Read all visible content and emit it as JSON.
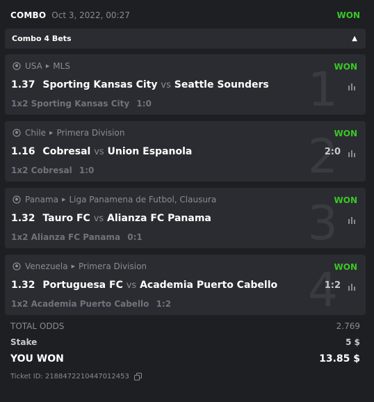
{
  "header": {
    "title": "COMBO",
    "date": "Oct 3, 2022, 00:27",
    "status": "WON"
  },
  "combo": {
    "label": "Combo 4 Bets",
    "toggle_icon": "caret-up-icon"
  },
  "bets": [
    {
      "country": "USA",
      "league": "MLS",
      "status": "WON",
      "odds": "1.37",
      "home": "Sporting Kansas City",
      "vs": "vs",
      "away": "Seattle Sounders",
      "score": "",
      "market": "1x2",
      "selection": "Sporting Kansas City",
      "result": "1:0",
      "index": "1"
    },
    {
      "country": "Chile",
      "league": "Primera Division",
      "status": "WON",
      "odds": "1.16",
      "home": "Cobresal",
      "vs": "vs",
      "away": "Union Espanola",
      "score": "2:0",
      "market": "1x2",
      "selection": "Cobresal",
      "result": "1:0",
      "index": "2"
    },
    {
      "country": "Panama",
      "league": "Liga Panamena de Futbol, Clausura",
      "status": "WON",
      "odds": "1.32",
      "home": "Tauro FC",
      "vs": "vs",
      "away": "Alianza FC Panama",
      "score": "",
      "market": "1x2",
      "selection": "Alianza FC Panama",
      "result": "0:1",
      "index": "3"
    },
    {
      "country": "Venezuela",
      "league": "Primera Division",
      "status": "WON",
      "odds": "1.32",
      "home": "Portuguesa FC",
      "vs": "vs",
      "away": "Academia Puerto Cabello",
      "score": "1:2",
      "market": "1x2",
      "selection": "Academia Puerto Cabello",
      "result": "1:2",
      "index": "4"
    }
  ],
  "totals": {
    "odds_label": "TOTAL ODDS",
    "odds_value": "2.769",
    "stake_label": "Stake",
    "stake_value": "5 $",
    "won_label": "YOU WON",
    "won_value": "13.85 $"
  },
  "ticket": {
    "text": "Ticket ID: 2188472210447012453",
    "copy_icon": "copy-icon"
  },
  "colors": {
    "won": "#38c926",
    "card": "#2b2c31",
    "background": "#1e1f23",
    "muted": "#8a8c92"
  }
}
